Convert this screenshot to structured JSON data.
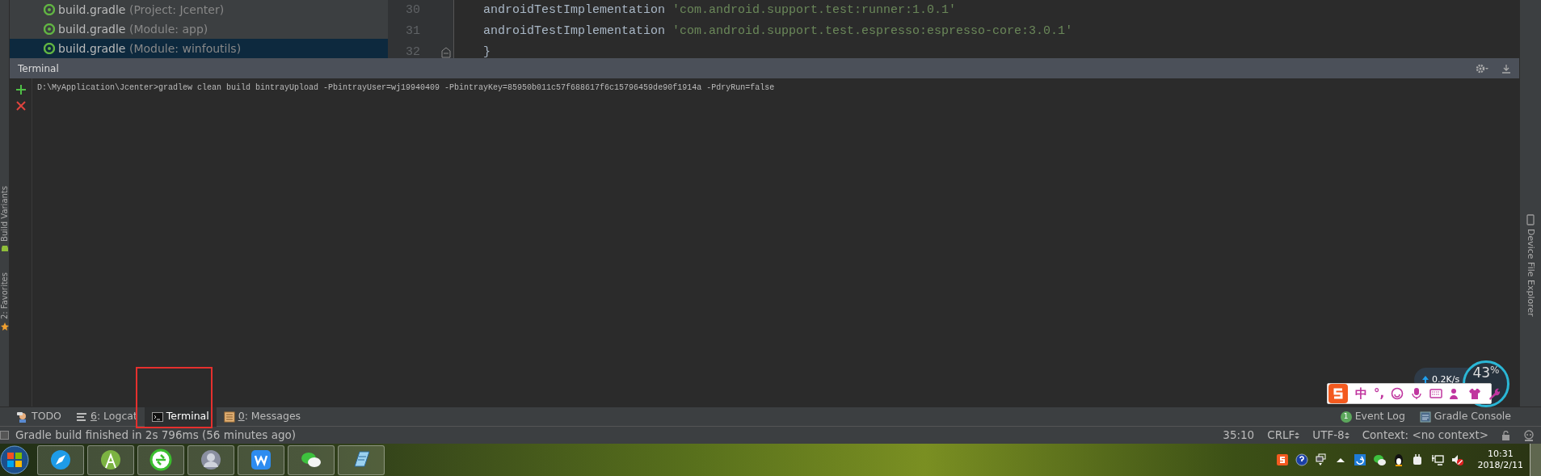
{
  "project_tree": {
    "items": [
      {
        "name": "build.gradle",
        "detail": "(Project: Jcenter)",
        "selected": false
      },
      {
        "name": "build.gradle",
        "detail": "(Module: app)",
        "selected": false
      },
      {
        "name": "build.gradle",
        "detail": "(Module: winfoutils)",
        "selected": true
      }
    ]
  },
  "editor": {
    "lines": [
      {
        "number": "30",
        "code": "androidTestImplementation ",
        "string": "'com.android.support.test:runner:1.0.1'"
      },
      {
        "number": "31",
        "code": "androidTestImplementation ",
        "string": "'com.android.support.test.espresso:espresso-core:3.0.1'"
      },
      {
        "number": "32",
        "code": "}",
        "fold": true
      }
    ]
  },
  "left_stripe": [
    {
      "label": "Build Variants",
      "kind": "android"
    },
    {
      "label": "2: Favorites",
      "kind": "star"
    }
  ],
  "terminal": {
    "title": "Terminal",
    "lines": [
      "D:\\MyApplication\\Jcenter>gradlew clean build bintrayUpload -PbintrayUser=wj19940409 -PbintrayKey=85950b011c57f688617f6c15796459de90f1914a -PdryRun=false"
    ]
  },
  "right_stripe": [
    {
      "label": "Device File Explorer"
    }
  ],
  "bottom_tabs": [
    {
      "label": "TODO",
      "kind": "todo",
      "mnemonic": false,
      "selected": false
    },
    {
      "label": "6: Logcat",
      "kind": "logcat",
      "mnemonic": true,
      "selected": false
    },
    {
      "label": "Terminal",
      "kind": "terminal",
      "mnemonic": false,
      "selected": true
    },
    {
      "label": "0: Messages",
      "kind": "messages",
      "mnemonic": true,
      "selected": false
    }
  ],
  "bottom_right_tabs": [
    {
      "label": "Event Log",
      "kind": "event",
      "badge": "1"
    },
    {
      "label": "Gradle Console",
      "kind": "console"
    }
  ],
  "status_bar": {
    "message": "Gradle build finished in 2s 796ms (56 minutes ago)",
    "position": "35:10",
    "line_separator": "CRLF",
    "encoding": "UTF-8",
    "context": "Context: <no context>"
  },
  "network_widget": {
    "speed": "0.2K/s",
    "percent": "43",
    "unit": "%"
  },
  "ime_toolbar": {
    "chars": [
      "中",
      "°,"
    ]
  },
  "taskbar": {
    "time": "10:31",
    "date": "2018/2/11"
  }
}
